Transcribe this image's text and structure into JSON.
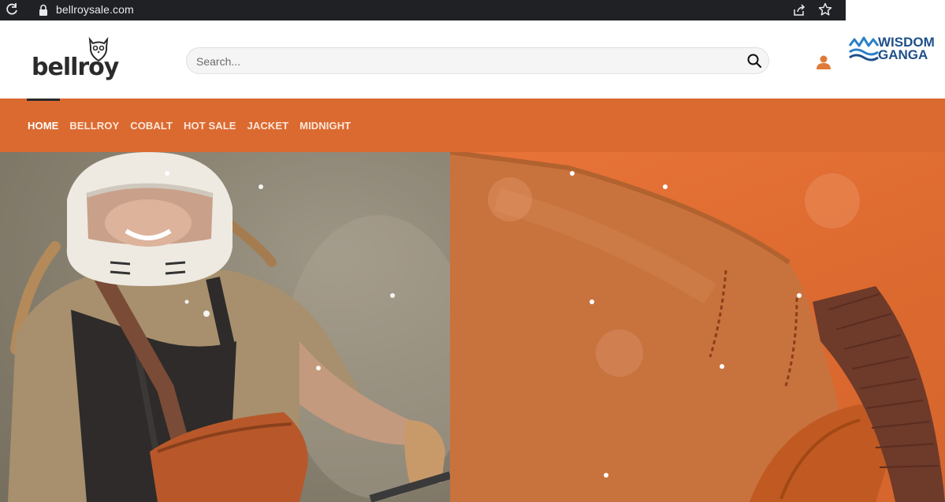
{
  "browser": {
    "url": "bellroysale.com",
    "icons": [
      "reload-icon",
      "lock-icon",
      "share-icon",
      "star-icon"
    ]
  },
  "header": {
    "logo_text": "bellroy",
    "search_placeholder": "Search...",
    "watermark_line1": "WISDOM",
    "watermark_line2": "GANGA"
  },
  "nav": {
    "items": [
      {
        "label": "HOME",
        "active": true
      },
      {
        "label": "BELLROY",
        "active": false
      },
      {
        "label": "COBALT",
        "active": false
      },
      {
        "label": "HOT SALE",
        "active": false
      },
      {
        "label": "JACKET",
        "active": false
      },
      {
        "label": "MIDNIGHT",
        "active": false
      }
    ]
  },
  "colors": {
    "nav_background": "#db6a31",
    "browser_bar": "#202124",
    "user_icon": "#e07a3a",
    "watermark_blue": "#1e4f8a"
  }
}
